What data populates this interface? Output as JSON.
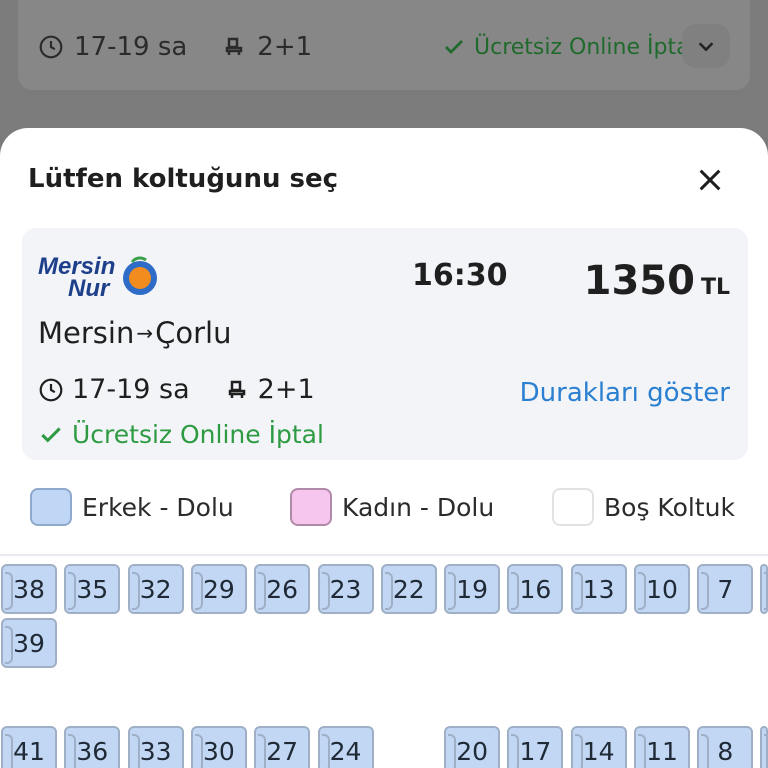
{
  "background_card": {
    "duration": "17-19 sa",
    "layout": "2+1",
    "cancel_text": "Ücretsiz Online İptal"
  },
  "sheet": {
    "title": "Lütfen koltuğunu seç"
  },
  "trip": {
    "company_logo_text": [
      "Mersin",
      "Nur"
    ],
    "departure_time": "16:30",
    "price_amount": "1350",
    "price_currency": "TL",
    "origin": "Mersin",
    "destination": "Çorlu",
    "route_arrow": "→",
    "duration": "17-19 sa",
    "layout": "2+1",
    "stops_link": "Durakları göster",
    "cancel_text": "Ücretsiz Online İptal"
  },
  "legend": [
    {
      "label": "Erkek - Dolu",
      "color": "#c0d6f5"
    },
    {
      "label": "Kadın - Dolu",
      "color": "#f7c6ee"
    },
    {
      "label": "Boş Koltuk",
      "color": "#ffffff"
    }
  ],
  "seats": {
    "row1": [
      "38",
      "35",
      "32",
      "29",
      "26",
      "23",
      "22",
      "19",
      "16",
      "13",
      "10",
      "7"
    ],
    "row2": [
      "39"
    ],
    "row3": [
      "41",
      "36",
      "33",
      "30",
      "27",
      "24",
      "20",
      "17",
      "14",
      "11",
      "8"
    ]
  },
  "colors": {
    "accent_blue": "#2a7fd1",
    "success_green": "#2e9b43",
    "male_seat": "#c2d7f4"
  }
}
